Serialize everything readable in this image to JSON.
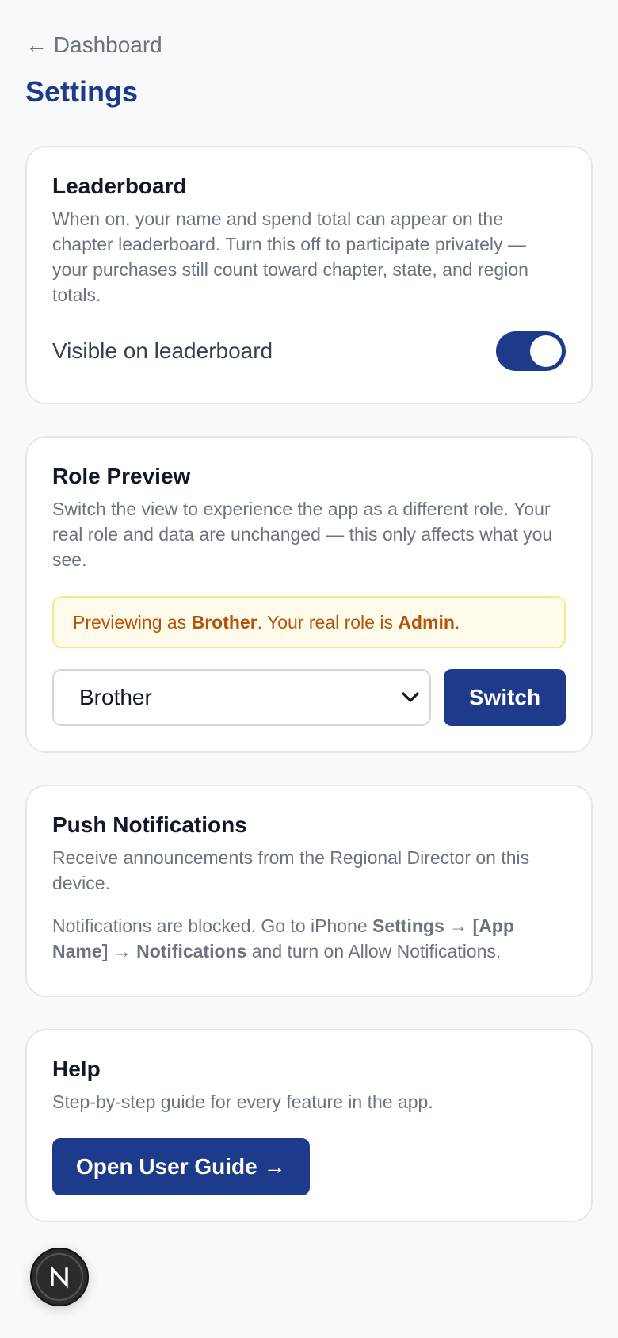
{
  "nav": {
    "back_label": "← Dashboard"
  },
  "page": {
    "title": "Settings"
  },
  "leaderboard": {
    "title": "Leaderboard",
    "description": "When on, your name and spend total can appear on the chapter leaderboard. Turn this off to participate privately — your purchases still count toward chapter, state, and region totals.",
    "toggle_label": "Visible on leaderboard",
    "toggle_on": true
  },
  "role_preview": {
    "title": "Role Preview",
    "description": "Switch the view to experience the app as a different role. Your real role and data are unchanged — this only affects what you see.",
    "notice": {
      "prefix": "Previewing as ",
      "preview_role": "Brother",
      "middle": ". Your real role is ",
      "real_role": "Admin",
      "suffix": "."
    },
    "selected_role": "Brother",
    "switch_label": "Switch"
  },
  "push": {
    "title": "Push Notifications",
    "description": "Receive announcements from the Regional Director on this device.",
    "status": {
      "part1": "Notifications are blocked. Go to iPhone ",
      "settings": "Settings",
      "arrow1": " → ",
      "app_name": "[App Name]",
      "arrow2": " → ",
      "notifications": "Notifications",
      "part2": " and turn on Allow Notifications."
    }
  },
  "help": {
    "title": "Help",
    "description": "Step-by-step guide for every feature in the app.",
    "button_label": "Open User Guide →"
  },
  "fab": {
    "letter": "N"
  },
  "colors": {
    "primary": "#1e3a8a",
    "background": "#f8f9fb",
    "notice_text": "#b45309",
    "notice_bg": "#fffbeb",
    "notice_border": "#fde68a"
  },
  "icons": {
    "select_chevron": "chevron-down-icon",
    "fab": "n-logo-icon"
  }
}
